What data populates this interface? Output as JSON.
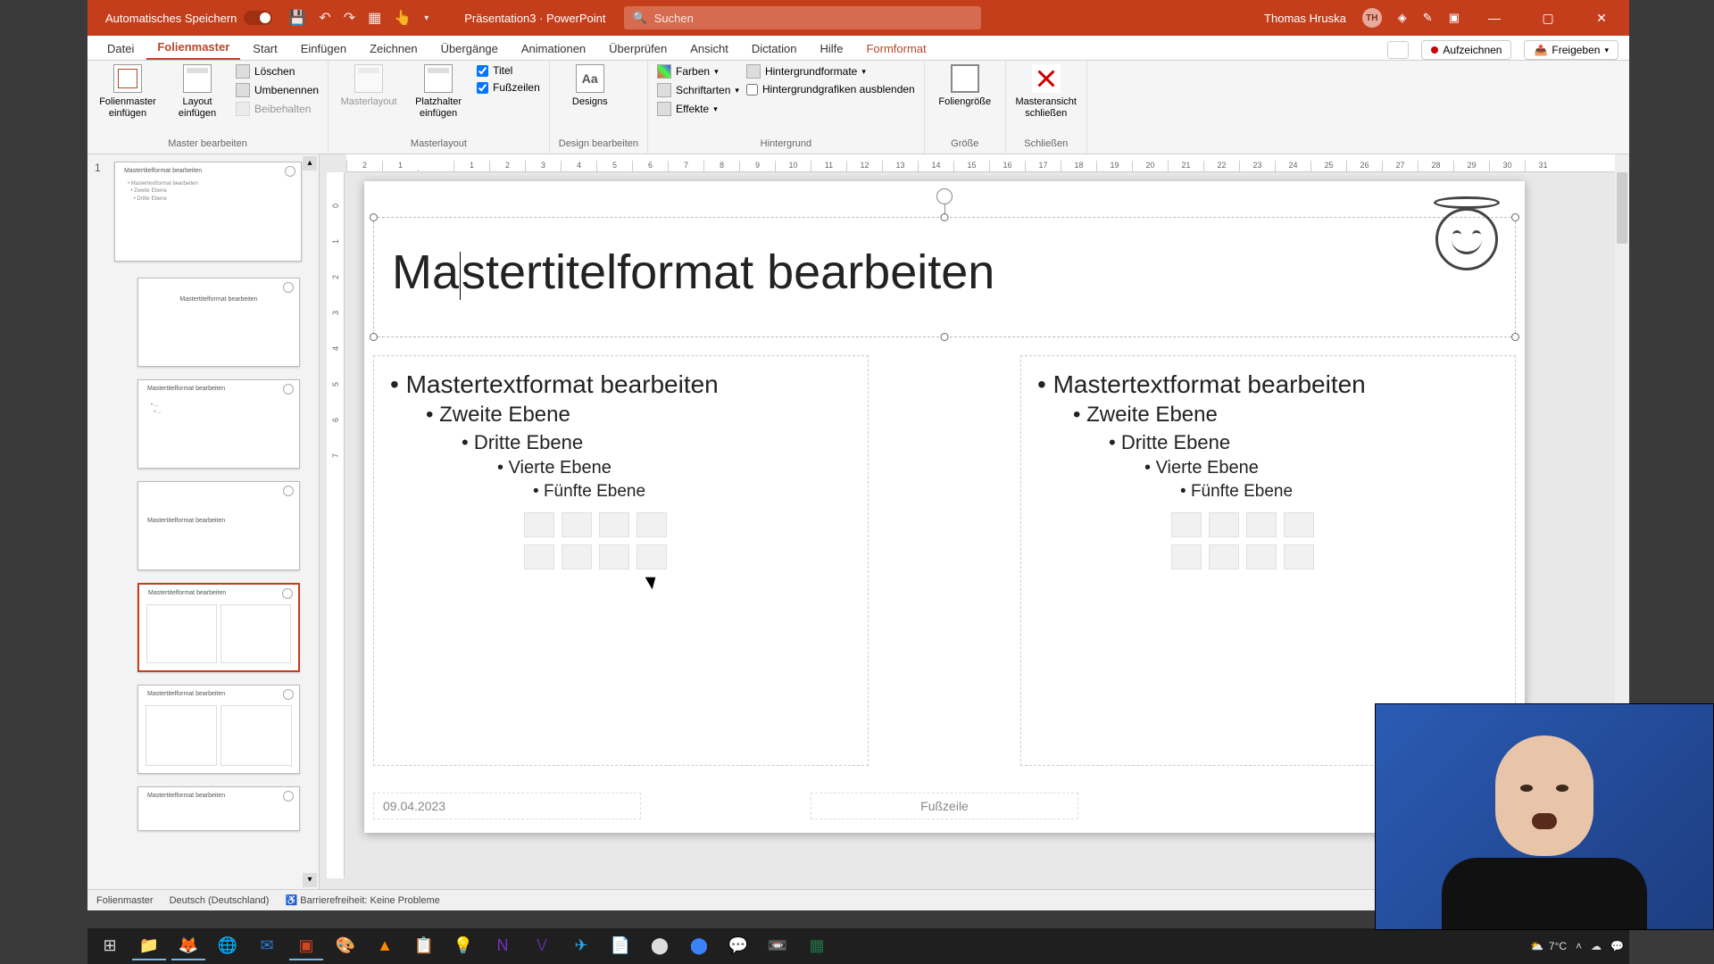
{
  "titlebar": {
    "autosave_label": "Automatisches Speichern",
    "doc_name": "Präsentation3",
    "app_name": "PowerPoint",
    "search_placeholder": "Suchen",
    "user_name": "Thomas Hruska",
    "user_initials": "TH"
  },
  "tabs": {
    "datei": "Datei",
    "folienmaster": "Folienmaster",
    "start": "Start",
    "einfuegen": "Einfügen",
    "zeichnen": "Zeichnen",
    "uebergaenge": "Übergänge",
    "animationen": "Animationen",
    "ueberpruefen": "Überprüfen",
    "ansicht": "Ansicht",
    "dictation": "Dictation",
    "hilfe": "Hilfe",
    "formformat": "Formformat",
    "aufzeichnen": "Aufzeichnen",
    "freigeben": "Freigeben"
  },
  "ribbon": {
    "master_bearbeiten": {
      "label": "Master bearbeiten",
      "folienmaster_einfuegen": "Folienmaster einfügen",
      "layout_einfuegen": "Layout einfügen",
      "loeschen": "Löschen",
      "umbenennen": "Umbenennen",
      "beibehalten": "Beibehalten"
    },
    "masterlayout": {
      "label": "Masterlayout",
      "masterlayout_btn": "Masterlayout",
      "platzhalter": "Platzhalter einfügen",
      "titel": "Titel",
      "fusszeilen": "Fußzeilen"
    },
    "design": {
      "label": "Design bearbeiten",
      "designs": "Designs"
    },
    "hintergrund": {
      "label": "Hintergrund",
      "farben": "Farben",
      "schriftarten": "Schriftarten",
      "effekte": "Effekte",
      "hintergrundformate": "Hintergrundformate",
      "hintergrundgrafiken": "Hintergrundgrafiken ausblenden"
    },
    "groesse": {
      "label": "Größe",
      "foliengroesse": "Foliengröße"
    },
    "schliessen": {
      "label": "Schließen",
      "masteransicht": "Masteransicht schließen"
    }
  },
  "slide": {
    "number": "1",
    "title": "Mastertitelformat bearbeiten",
    "levels": {
      "l1": "Mastertextformat bearbeiten",
      "l2": "Zweite Ebene",
      "l3": "Dritte Ebene",
      "l4": "Vierte Ebene",
      "l5": "Fünfte Ebene"
    },
    "footer": {
      "date": "09.04.2023",
      "footer_text": "Fußzeile"
    }
  },
  "thumb_title": "Mastertitelformat bearbeiten",
  "statusbar": {
    "view": "Folienmaster",
    "language": "Deutsch (Deutschland)",
    "accessibility": "Barrierefreiheit: Keine Probleme"
  },
  "taskbar": {
    "weather": "7°C"
  },
  "ruler_h": [
    "2",
    "1",
    "",
    "1",
    "2",
    "3",
    "4",
    "5",
    "6",
    "7",
    "8",
    "9",
    "10",
    "11",
    "12",
    "13",
    "14",
    "15",
    "16",
    "17",
    "18",
    "19",
    "20",
    "21",
    "22",
    "23",
    "24",
    "25",
    "26",
    "27",
    "28",
    "29",
    "30",
    "31"
  ],
  "ruler_v": [
    "0",
    "1",
    "2",
    "3",
    "4",
    "5",
    "6",
    "7"
  ]
}
